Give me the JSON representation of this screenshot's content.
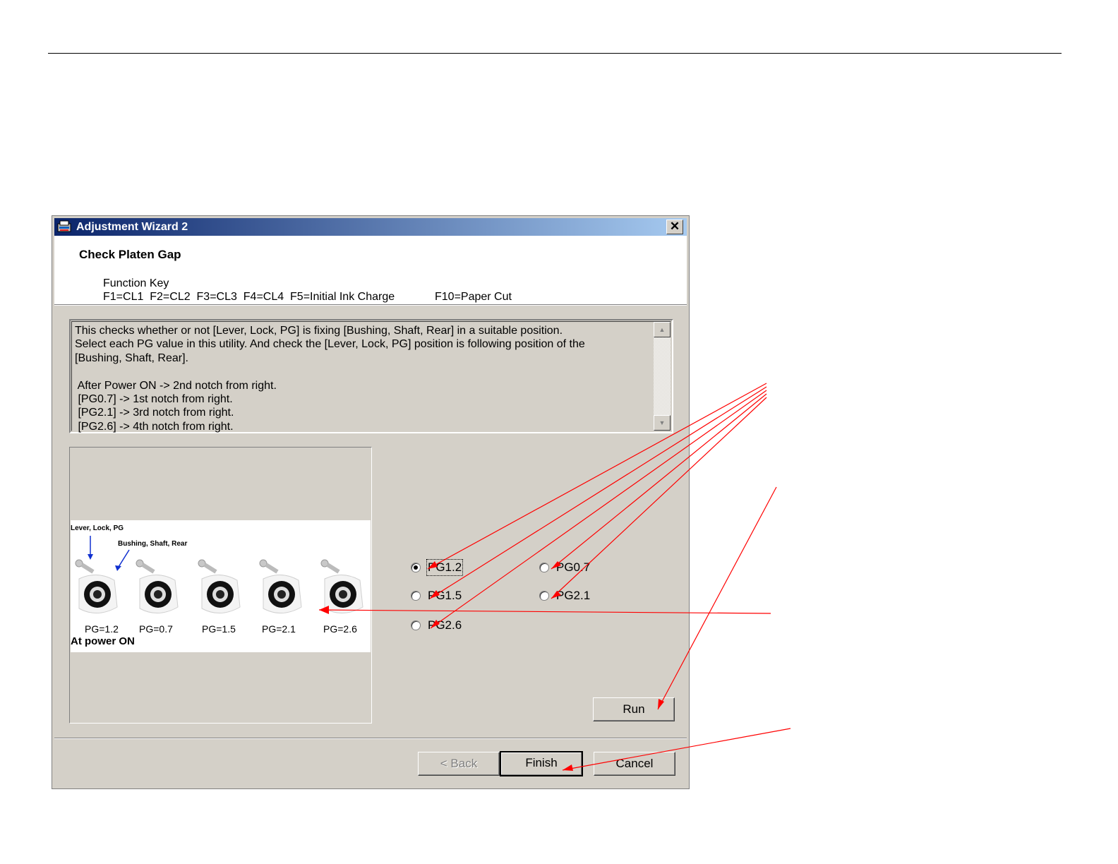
{
  "window": {
    "title": "Adjustment Wizard 2",
    "close_label": "✕"
  },
  "header": {
    "title": "Check Platen Gap",
    "function_key_label": "Function Key",
    "function_keys": "F1=CL1  F2=CL2  F3=CL3  F4=CL4  F5=Initial Ink Charge",
    "function_keys_extra": "F10=Paper Cut"
  },
  "description": {
    "text": "This checks whether or not [Lever, Lock, PG] is fixing [Bushing, Shaft, Rear] in a suitable position.\nSelect each PG value in this utility. And check the [Lever, Lock, PG] position is following position of the\n[Bushing, Shaft, Rear].\n\n After Power ON -> 2nd notch from right.\n [PG0.7] -> 1st notch from right.\n [PG2.1] -> 3rd notch from right.\n [PG2.6] -> 4th notch from right."
  },
  "diagram": {
    "label_lever": "Lever, Lock, PG",
    "label_bushing": "Bushing, Shaft, Rear",
    "positions": [
      "PG=1.2",
      "PG=0.7",
      "PG=1.5",
      "PG=2.1",
      "PG=2.6"
    ],
    "caption": "At power ON"
  },
  "radios": {
    "pg12": {
      "label": "PG1.2",
      "checked": true
    },
    "pg07": {
      "label": "PG0.7",
      "checked": false
    },
    "pg15": {
      "label": "PG1.5",
      "checked": false
    },
    "pg21": {
      "label": "PG2.1",
      "checked": false
    },
    "pg26": {
      "label": "PG2.6",
      "checked": false
    }
  },
  "buttons": {
    "run": "Run",
    "back": "< Back",
    "finish": "Finish",
    "cancel": "Cancel"
  },
  "colors": {
    "annotation_arrow": "#ff0000",
    "titlebar_start": "#0a246a",
    "titlebar_end": "#a6caf0",
    "dialog_bg": "#d4d0c8"
  }
}
